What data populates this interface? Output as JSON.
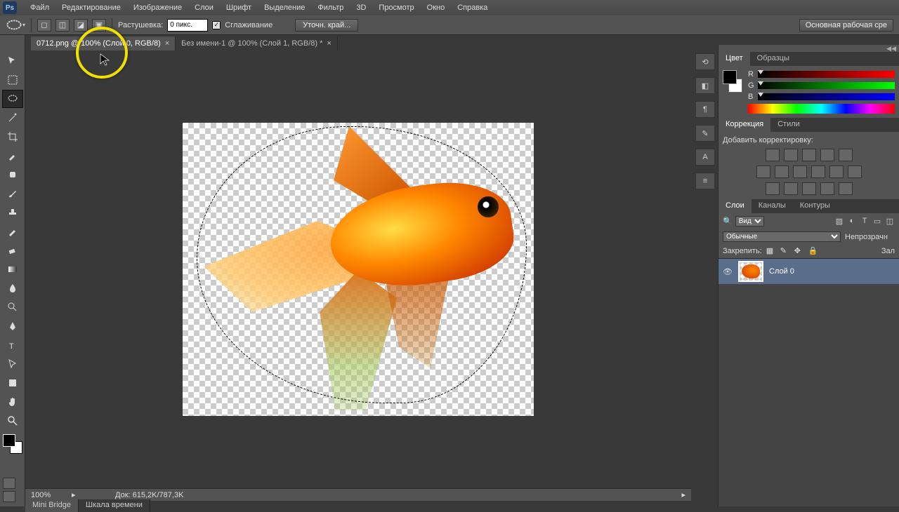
{
  "menu": {
    "items": [
      "Файл",
      "Редактирование",
      "Изображение",
      "Слои",
      "Шрифт",
      "Выделение",
      "Фильтр",
      "3D",
      "Просмотр",
      "Окно",
      "Справка"
    ]
  },
  "optbar": {
    "feather_label": "Растушевка:",
    "feather_value": "0 пикс.",
    "antialias_label": "Сглаживание",
    "refine_label": "Уточн. край...",
    "workspace_label": "Основная рабочая сре"
  },
  "tabs": [
    {
      "label": "0712.png @ 100% (Слой 0, RGB/8)",
      "active": true
    },
    {
      "label": "Без имени-1 @ 100% (Слой 1, RGB/8) *",
      "active": false
    }
  ],
  "panels": {
    "color": {
      "tabs": [
        "Цвет",
        "Образцы"
      ],
      "channels": [
        "R",
        "G",
        "B"
      ]
    },
    "correction": {
      "tabs": [
        "Коррекция",
        "Стили"
      ],
      "add_label": "Добавить корректировку:"
    },
    "layers": {
      "tabs": [
        "Слои",
        "Каналы",
        "Контуры"
      ],
      "kind_label": "Вид",
      "blend_mode": "Обычные",
      "opacity_label": "Непрозрачн",
      "lock_label": "Закрепить:",
      "fill_label": "Зал",
      "layer0_name": "Слой 0"
    }
  },
  "status": {
    "zoom": "100%",
    "doc_size": "Док: 615,2K/787,3K"
  },
  "bottom_tabs": [
    "Mini Bridge",
    "Шкала времени"
  ]
}
